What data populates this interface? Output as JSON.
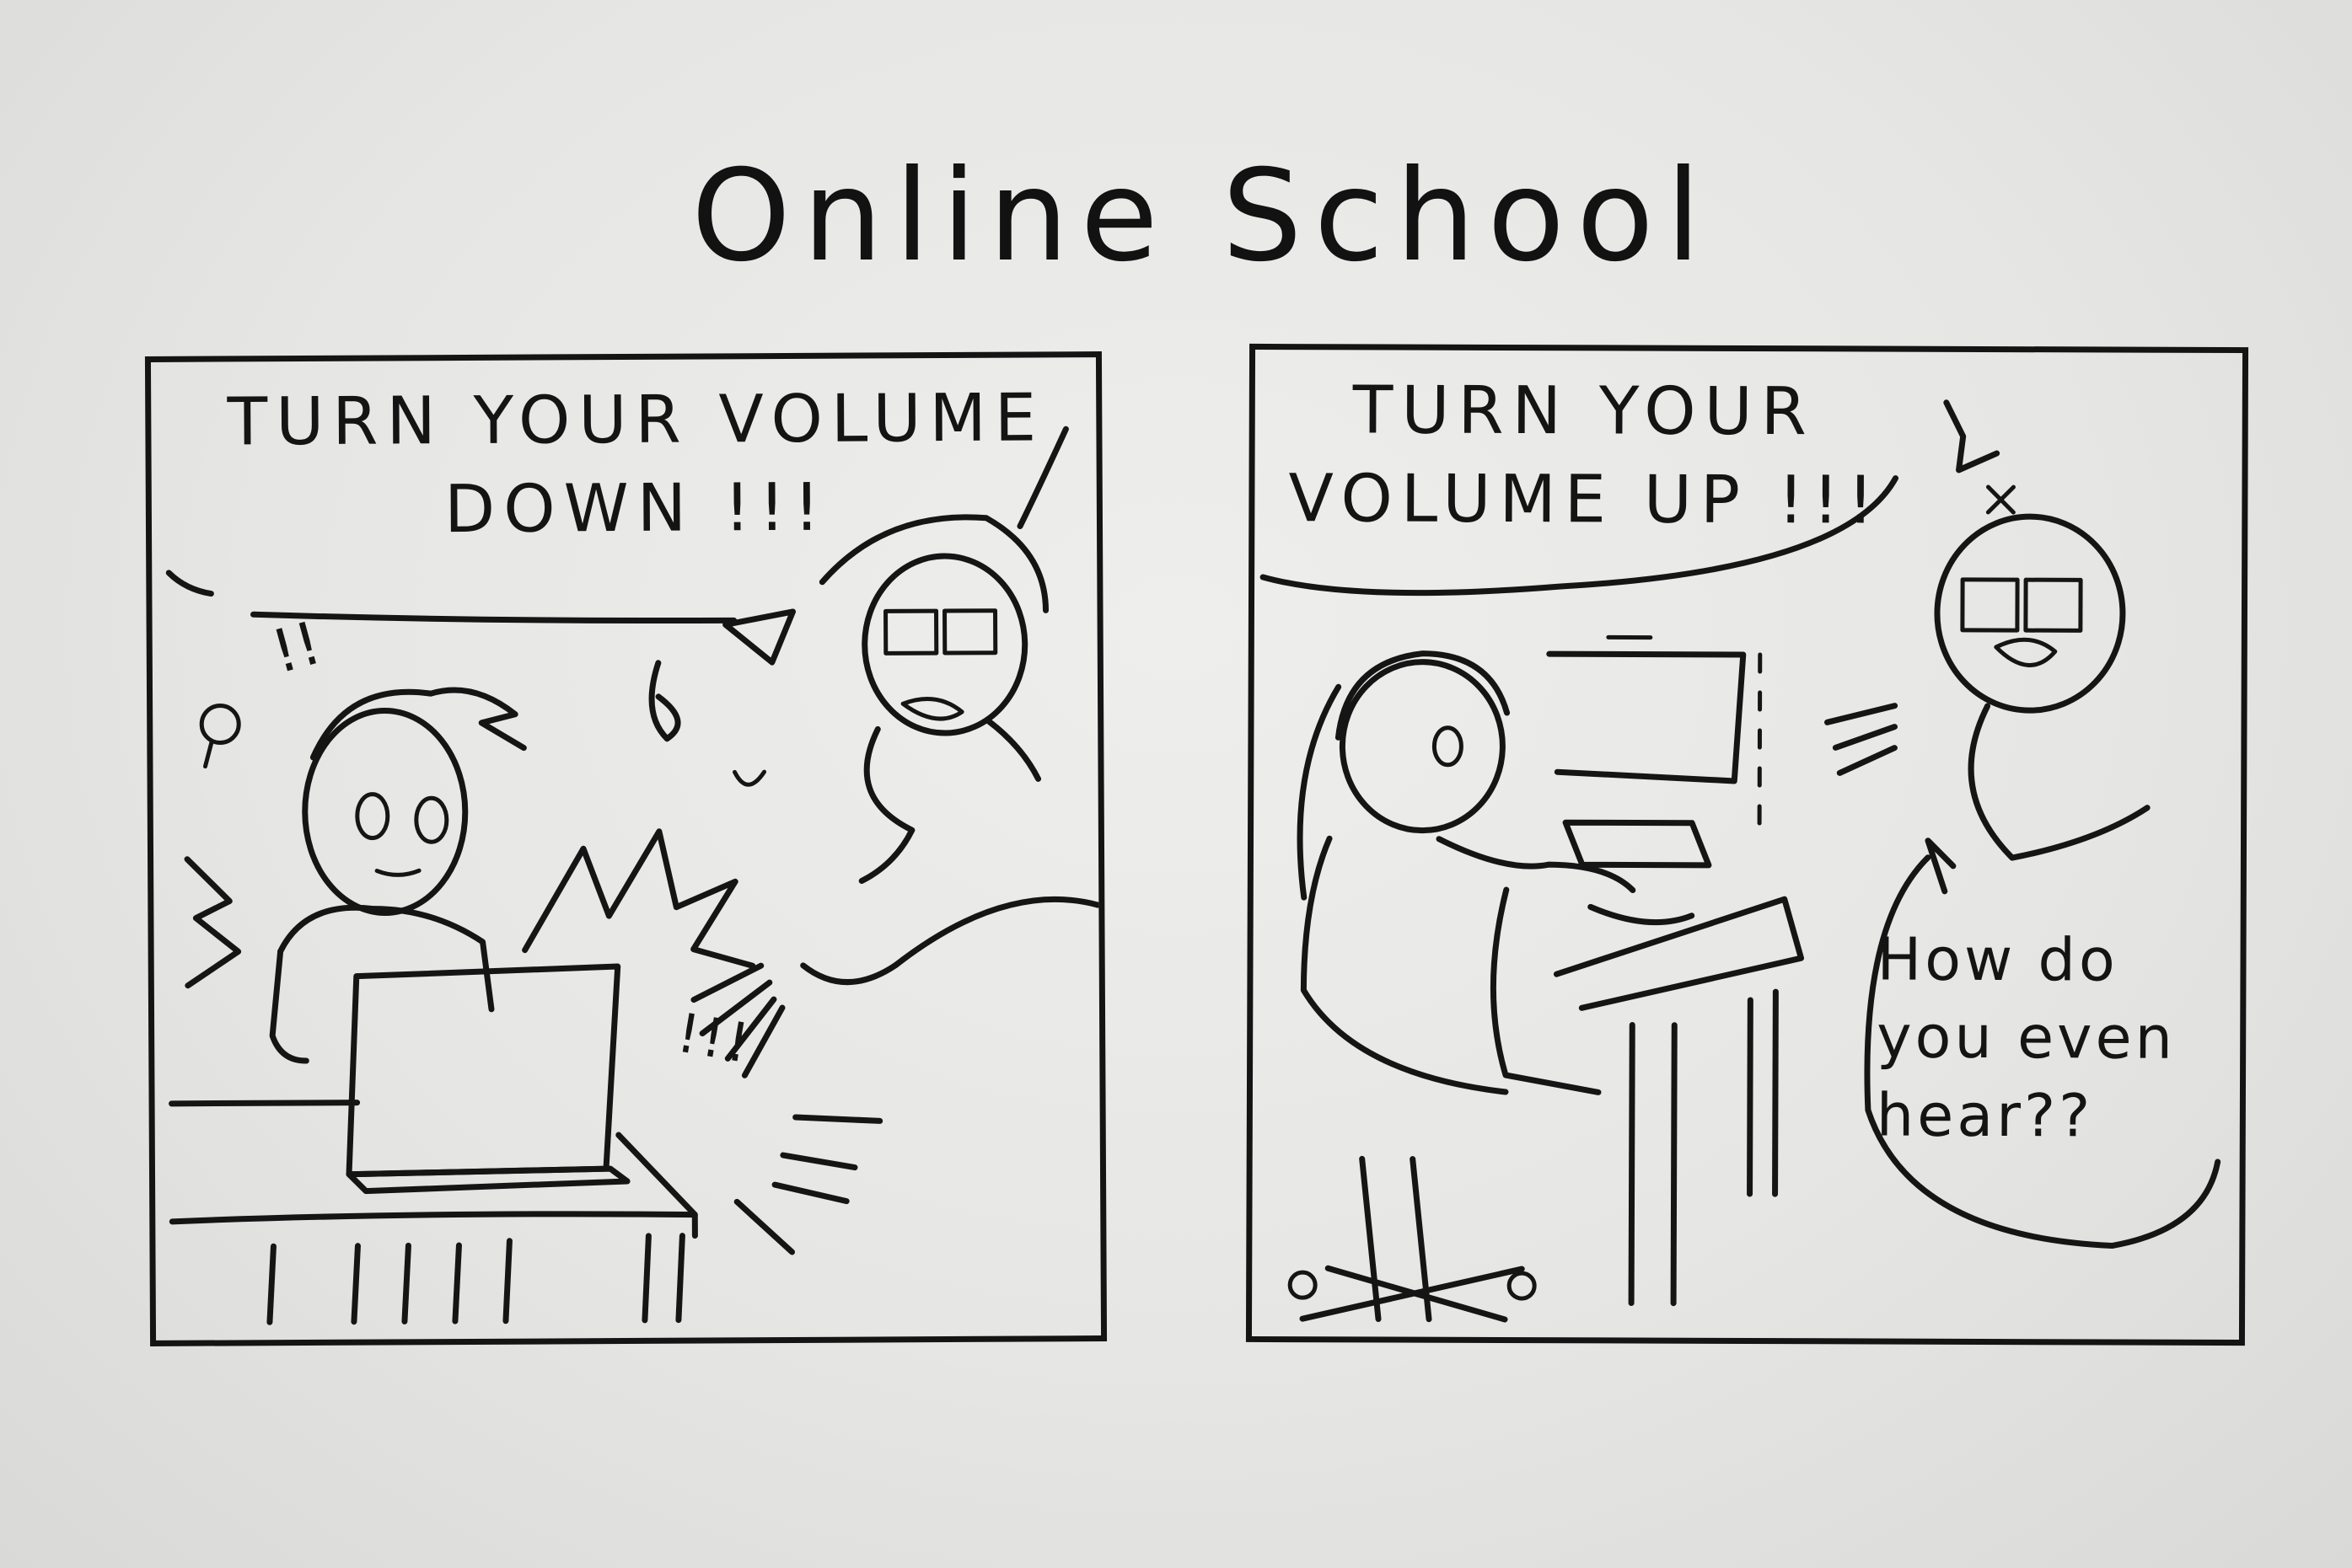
{
  "title": "Online School",
  "panels": [
    {
      "speech_line_1": "TURN YOUR VOLUME",
      "speech_line_2": "DOWN !!!",
      "exclaim": "!!!"
    },
    {
      "speech_line_1": "TURN YOUR",
      "speech_line_2": "VOLUME UP !!!",
      "reply_lines": [
        "How do",
        "you even",
        "hear??"
      ]
    }
  ]
}
